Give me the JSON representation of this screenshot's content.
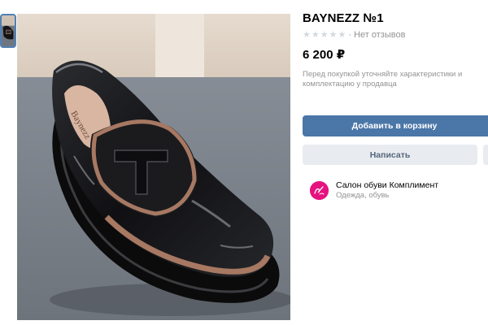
{
  "product": {
    "title": "BAYNEZZ №1",
    "rating_stars": 5,
    "reviews": "· Нет отзывов",
    "price": "6 200 ₽",
    "note": "Перед покупкой уточняйте характеристики и комплектацию у продавца",
    "insole_brand": "Baynezz"
  },
  "actions": {
    "add_to_cart": "Добавить в корзину",
    "write": "Написать"
  },
  "seller": {
    "name": "Салон обуви Комплимент",
    "category": "Одежда, обувь"
  },
  "colors": {
    "accent": "#4a76a8",
    "secondary_bg": "#e8ebef",
    "secondary_text": "#55677d",
    "muted_text": "#939393",
    "avatar": "#e5127f"
  }
}
